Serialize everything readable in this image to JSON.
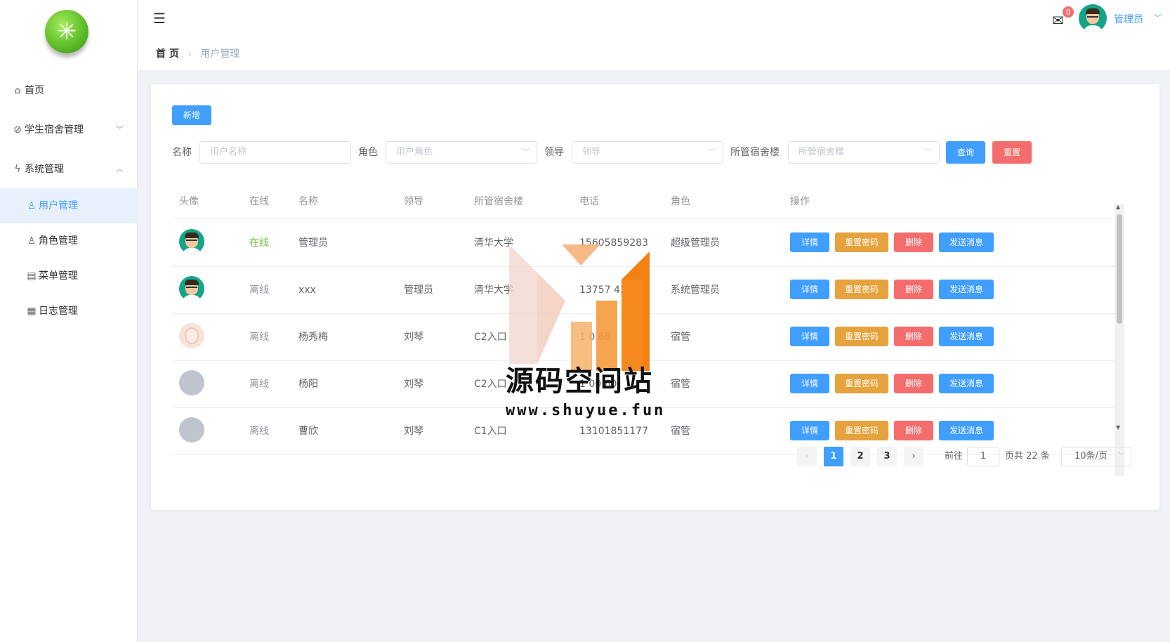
{
  "sidebar": {
    "items": [
      {
        "label": "首页",
        "icon": "home-icon"
      },
      {
        "label": "学生宿舍管理",
        "icon": "paperclip-icon"
      },
      {
        "label": "系统管理",
        "icon": "lightning-icon"
      },
      {
        "label": "用户管理",
        "icon": "user-icon"
      },
      {
        "label": "角色管理",
        "icon": "user-setting-icon"
      },
      {
        "label": "菜单管理",
        "icon": "menu-icon"
      },
      {
        "label": "日志管理",
        "icon": "log-icon"
      }
    ]
  },
  "header": {
    "breadcrumb": {
      "home": "首 页",
      "current": "用户管理"
    },
    "mail_badge": "0",
    "user_name": "管理员"
  },
  "toolbar": {
    "add_label": "新增"
  },
  "filters": {
    "name_label": "名称",
    "name_placeholder": "用户名称",
    "role_label": "角色",
    "role_placeholder": "用户角色",
    "leader_label": "领导",
    "leader_placeholder": "领导",
    "dorm_label": "所管宿舍楼",
    "dorm_placeholder": "所管宿舍楼",
    "query_label": "查询",
    "reset_label": "重置"
  },
  "table": {
    "headers": [
      "头像",
      "在线",
      "名称",
      "领导",
      "所管宿舍楼",
      "电话",
      "角色",
      "操作"
    ],
    "actions": {
      "detail": "详情",
      "reset_pwd": "重置密码",
      "delete": "删除",
      "send": "发送消息"
    },
    "rows": [
      {
        "online": "在线",
        "name": "管理员",
        "leader": "",
        "dorm": "清华大学",
        "phone": "15605859283",
        "role": "超级管理员"
      },
      {
        "online": "离线",
        "name": "xxx",
        "leader": "管理员",
        "dorm": "清华大学",
        "phone": "13757      43",
        "role": "系统管理员"
      },
      {
        "online": "离线",
        "name": "杨秀梅",
        "leader": "刘琴",
        "dorm": "C2入口",
        "phone": "1   0      68",
        "role": "宿管"
      },
      {
        "online": "离线",
        "name": "杨阳",
        "leader": "刘琴",
        "dorm": "C2入口",
        "phone": "1   00      60",
        "role": "宿管"
      },
      {
        "online": "离线",
        "name": "曹欣",
        "leader": "刘琴",
        "dorm": "C1入口",
        "phone": "13101851177",
        "role": "宿管"
      }
    ]
  },
  "pagination": {
    "pages": [
      "1",
      "2",
      "3"
    ],
    "goto_label": "前往",
    "goto_value": "1",
    "total_label": "页共 22 条",
    "page_size": "10条/页"
  },
  "watermark": {
    "title": "源码空间站",
    "url": "www.shuyue.fun"
  },
  "colors": {
    "primary": "#409eff",
    "danger": "#f56c6c",
    "warning": "#e6a23c",
    "success": "#67c23a"
  }
}
